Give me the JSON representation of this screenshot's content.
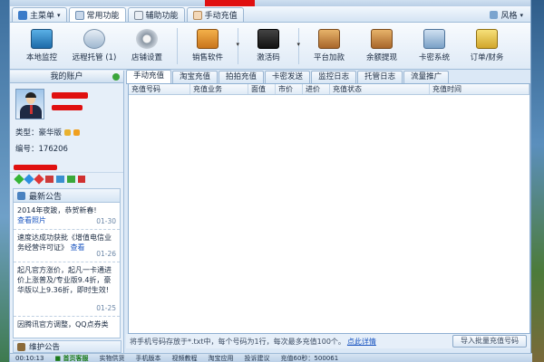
{
  "menubar": {
    "main_menu": "主菜单",
    "tabs": [
      "常用功能",
      "辅助功能",
      "手动充值"
    ],
    "style_label": "风格"
  },
  "toolbar": {
    "items": [
      {
        "label": "本地监控",
        "icon": "monitor-icon"
      },
      {
        "label": "远程托管 (1)",
        "icon": "remote-hosting-icon"
      },
      {
        "label": "店铺设置",
        "icon": "gear-icon"
      },
      {
        "label": "销售软件",
        "icon": "sales-software-icon"
      },
      {
        "label": "激活码",
        "icon": "activation-code-icon"
      },
      {
        "label": "平台加款",
        "icon": "platform-deposit-icon"
      },
      {
        "label": "余额提现",
        "icon": "withdraw-icon"
      },
      {
        "label": "卡密系统",
        "icon": "card-system-icon"
      },
      {
        "label": "订单/财务",
        "icon": "orders-finance-icon"
      }
    ]
  },
  "account": {
    "title": "我的账户",
    "type_label": "类型：豪华版",
    "id_label": "编号：176206"
  },
  "news": {
    "title": "最新公告",
    "items": [
      {
        "text": "2014年夜跛，恭贺新春!",
        "more": "查看照片",
        "date": "01-30"
      },
      {
        "text": "速度达成功获批《增值电信业务经营许可证》",
        "more": "查看",
        "date": "01-26"
      },
      {
        "text": "起凡官方涨价，起凡一卡通进价上涨普及/专业版9.4折，豪华版以上9.36折，即时生效!",
        "more": "",
        "date": "01-25"
      },
      {
        "text": "因腾讯官方调整，QQ点券类",
        "more": "",
        "date": ""
      }
    ],
    "maintenance": "维护公告"
  },
  "main": {
    "tabs": [
      "手动充值",
      "淘宝充值",
      "拍拍充值",
      "卡密发送",
      "监控日志",
      "托管日志",
      "流量推广"
    ],
    "columns": [
      "充值号码",
      "充值业务",
      "面值",
      "市价",
      "进价",
      "充值状态",
      "充值时间"
    ],
    "hint": "将手机号码存放于*.txt中，每个号码为1行，每次最多充值100个。",
    "hint_link": "点此详情",
    "import_button": "导入批量充值号码"
  },
  "statusbar": {
    "items": [
      "00:10:13",
      "■ 首页客服",
      "实物供货",
      "手机版本",
      "视频教程",
      "淘宝应用",
      "投诉建议",
      "充值60秒：500061"
    ]
  }
}
